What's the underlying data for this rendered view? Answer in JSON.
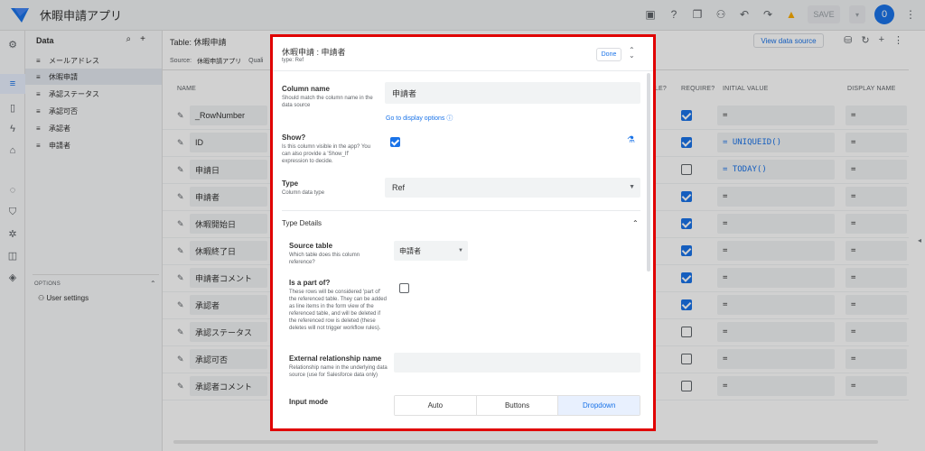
{
  "header": {
    "app_title": "休暇申請アプリ",
    "save_label": "SAVE",
    "avatar_letter": "0"
  },
  "data_panel": {
    "title": "Data",
    "items": [
      "メールアドレス",
      "休暇申請",
      "承認ステータス",
      "承認可否",
      "承認者",
      "申請者"
    ],
    "options_label": "OPTIONS",
    "user_settings": "User settings"
  },
  "table": {
    "title": "Table: 休暇申請",
    "source_label": "Source:",
    "source_value": "休暇申請アプリ",
    "qualifier": "Quali",
    "view_source": "View data source",
    "columns": {
      "name": "NAME",
      "editable": "BLE?",
      "require": "REQUIRE?",
      "initial": "INITIAL VALUE",
      "display": "DISPLAY NAME"
    },
    "rows": [
      {
        "name": "_RowNumber",
        "require": true,
        "initial": "=",
        "display": "="
      },
      {
        "name": "ID",
        "require": true,
        "initial": "= UNIQUEID()",
        "display": "="
      },
      {
        "name": "申請日",
        "require": false,
        "initial": "= TODAY()",
        "display": "="
      },
      {
        "name": "申請者",
        "require": true,
        "initial": "=",
        "display": "="
      },
      {
        "name": "休暇開始日",
        "require": true,
        "initial": "=",
        "display": "="
      },
      {
        "name": "休暇終了日",
        "require": true,
        "initial": "=",
        "display": "="
      },
      {
        "name": "申請者コメント",
        "require": true,
        "initial": "=",
        "display": "="
      },
      {
        "name": "承認者",
        "require": true,
        "initial": "=",
        "display": "="
      },
      {
        "name": "承認ステータス",
        "require": false,
        "initial": "=",
        "display": "="
      },
      {
        "name": "承認可否",
        "require": false,
        "initial": "=",
        "display": "="
      },
      {
        "name": "承認者コメント",
        "require": false,
        "initial": "=",
        "display": "="
      }
    ]
  },
  "modal": {
    "title": "休暇申請 : 申請者",
    "subtitle": "type: Ref",
    "done_label": "Done",
    "column_name_label": "Column name",
    "column_name_desc": "Should match the column name in the data source",
    "column_name_value": "申請者",
    "goto_display": "Go to display options",
    "show_label": "Show?",
    "show_desc": "Is this column visible in the app? You can also provide a 'Show_If' expression to decide.",
    "show_checked": true,
    "type_label": "Type",
    "type_desc": "Column data type",
    "type_value": "Ref",
    "type_details": "Type Details",
    "source_table_label": "Source table",
    "source_table_desc": "Which table does this column reference?",
    "source_table_value": "申請者",
    "part_of_label": "Is a part of?",
    "part_of_desc": "These rows will be considered 'part of' the referenced table. They can be added as line items in the form view of the referenced table, and will be deleted if the referenced row is deleted (these deletes will not trigger workflow rules).",
    "part_of_checked": false,
    "ext_rel_label": "External relationship name",
    "ext_rel_desc": "Relationship name in the underlying data source (use for Salesforce data only)",
    "ext_rel_value": "",
    "input_mode_label": "Input mode",
    "input_modes": [
      "Auto",
      "Buttons",
      "Dropdown"
    ],
    "input_mode_selected": "Dropdown"
  },
  "colors": {
    "accent": "#1a73e8",
    "highlight_border": "#e00000"
  }
}
